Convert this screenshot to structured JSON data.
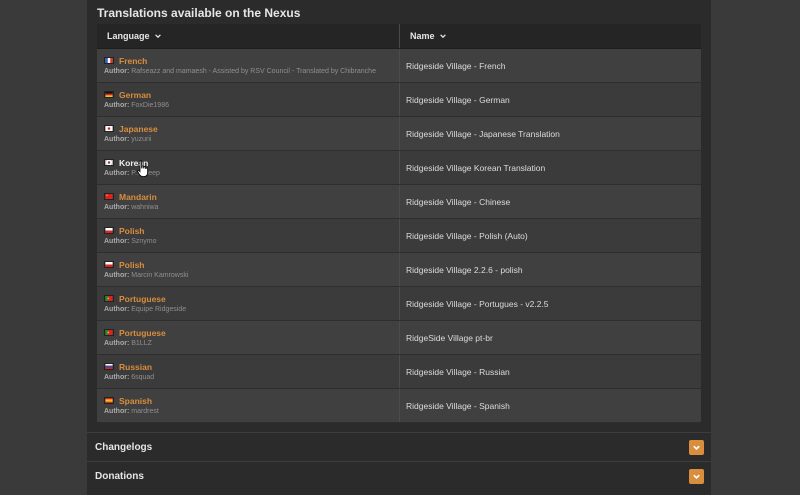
{
  "section_title": "Translations available on the Nexus",
  "table": {
    "col_language": "Language",
    "col_name": "Name",
    "author_label": "Author:",
    "rows": [
      {
        "language": "French",
        "flag": "fr",
        "author": "Rafseazz and mamaesh - Assisted by RSV Council - Translated by Chibranche",
        "name": "Ridgeside Village - French"
      },
      {
        "language": "German",
        "flag": "de",
        "author": "FoxDie1986",
        "name": "Ridgeside Village - German"
      },
      {
        "language": "Japanese",
        "flag": "jp",
        "author": "yuzurii",
        "name": "Ridgeside Village - Japanese Translation"
      },
      {
        "language": "Korean",
        "flag": "kr",
        "author": "P...sheep",
        "name": "Ridgeside Village Korean Translation"
      },
      {
        "language": "Mandarin",
        "flag": "cn",
        "author": "wahniwa",
        "name": "Ridgeside Village - Chinese"
      },
      {
        "language": "Polish",
        "flag": "pl",
        "author": "Sznymo",
        "name": "Ridgeside Village - Polish (Auto)"
      },
      {
        "language": "Polish",
        "flag": "pl",
        "author": "Marcin Kamrowski",
        "name": "Ridgeside Village 2.2.6 - polish"
      },
      {
        "language": "Portuguese",
        "flag": "pt",
        "author": "Equipe Ridgeside",
        "name": "Ridgeside Village - Portugues - v2.2.5"
      },
      {
        "language": "Portuguese",
        "flag": "pt",
        "author": "B1LLZ",
        "name": "RidgeSide Village pt-br"
      },
      {
        "language": "Russian",
        "flag": "ru",
        "author": "6squad",
        "name": "Ridgeside Village - Russian"
      },
      {
        "language": "Spanish",
        "flag": "es",
        "author": "mardrest",
        "name": "Ridgeside Village - Spanish"
      }
    ]
  },
  "changelogs_label": "Changelogs",
  "donations_label": "Donations",
  "colors": {
    "accent": "#d98e3e",
    "panel": "#2b2b2b",
    "page": "#3a3a3a"
  },
  "hover_row_index": 3
}
